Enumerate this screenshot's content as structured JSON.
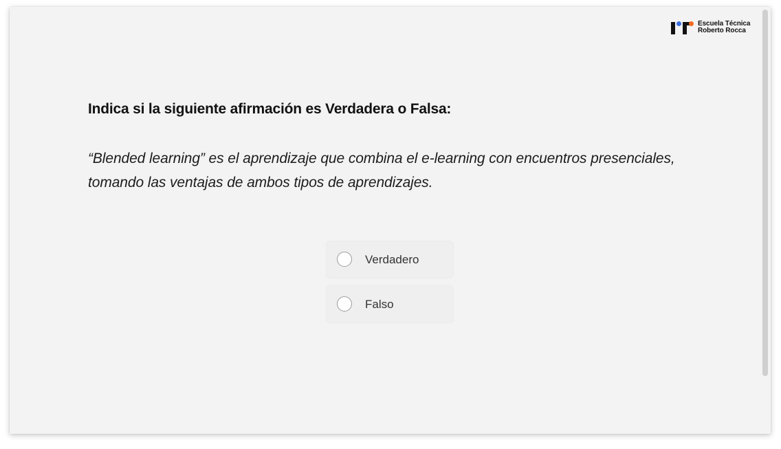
{
  "brand": {
    "name_line1": "Escuela Técnica",
    "name_line2": "Roberto Rocca",
    "colors": {
      "blue": "#3b6fe0",
      "orange": "#f36b21",
      "dark": "#121212"
    }
  },
  "question": {
    "title": "Indica si la siguiente afirmación es Verdadera o Falsa:",
    "statement": "“Blended learning” es el aprendizaje que combina el e-learning con encuentros presenciales, tomando las ventajas de ambos tipos de aprendizajes."
  },
  "options": [
    {
      "label": "Verdadero",
      "selected": false
    },
    {
      "label": "Falso",
      "selected": false
    }
  ]
}
